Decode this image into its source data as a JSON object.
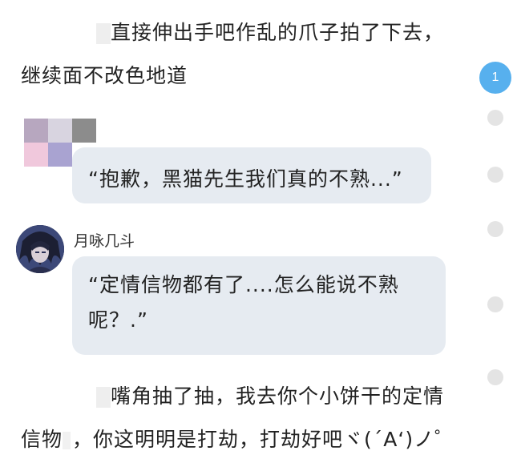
{
  "narration_1": {
    "line1": "直接伸出手吧作乱的爪子拍了下去，",
    "line2": "继续面不改色地道"
  },
  "message_1": {
    "text": "“抱歉，黑猫先生我们真的不熟...”"
  },
  "message_2": {
    "username": "月咏几斗",
    "text": "“定情信物都有了....怎么能说不熟呢？.”"
  },
  "narration_2": {
    "line1": "嘴角抽了抽，我去你个小饼干的定情",
    "line2_a": "信物",
    "line2_b": "，你这明明是打劫，打劫好吧ヾ(´A‘)ノ゜"
  },
  "comment_badge": {
    "count": "1",
    "color": "#57b0ee"
  },
  "colors": {
    "bubble_bg": "#e6ebf1",
    "side_dot": "#e4e4e4",
    "text": "#222222"
  },
  "mosaic_colors": [
    "#b7a7bf",
    "#d8d4e0",
    "#8c8c8c",
    "#f0c8dc",
    "#a9a3d1",
    "#ffffff"
  ]
}
